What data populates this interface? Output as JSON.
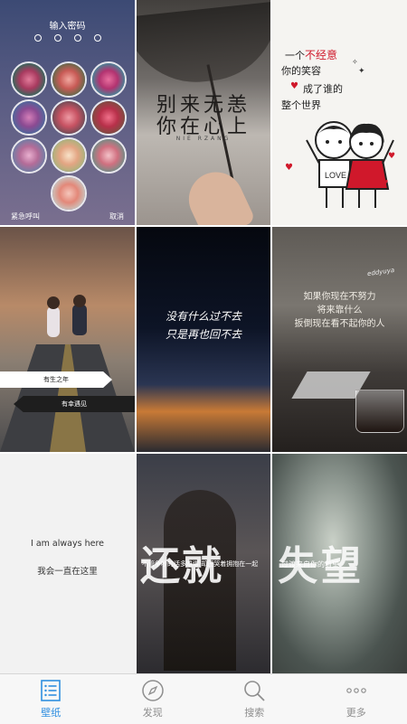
{
  "wallpapers": {
    "lock": {
      "title": "输入密码",
      "emergency": "紧急呼叫",
      "cancel": "取消"
    },
    "umbrella": {
      "line1": "别来无恙",
      "line2": "你在心上",
      "sub": "NIE RZANG"
    },
    "cartoon": {
      "line1a": "一个",
      "line1b": "不经意",
      "line2": "你的笑容",
      "line3": "成了谁的",
      "line4": "整个世界",
      "shirt": "LOVE"
    },
    "road": {
      "banner1": "有生之年",
      "banner2": "有幸遇见"
    },
    "night": {
      "line1": "没有什么过不去",
      "line2": "只是再也回不去"
    },
    "coffee": {
      "signature": "eddyuya",
      "line1": "如果你现在不努力",
      "line2": "将来靠什么",
      "line3": "扳倒现在看不起你的人"
    },
    "quote": {
      "line1": "I am always here",
      "line2": "我会一直在这里"
    },
    "couple": {
      "big": "还就",
      "small": "不管争吵的话多难堪 却还哭着拥抱在一起"
    },
    "smoke": {
      "big": "失望",
      "small": "过渡来自你的着望"
    }
  },
  "tabbar": {
    "tabs": [
      {
        "label": "壁纸",
        "icon": "list-icon",
        "active": true
      },
      {
        "label": "发现",
        "icon": "compass-icon",
        "active": false
      },
      {
        "label": "搜索",
        "icon": "search-icon",
        "active": false
      },
      {
        "label": "更多",
        "icon": "more-icon",
        "active": false
      }
    ],
    "active_color": "#2f8fe0",
    "inactive_color": "#8e8e8e"
  }
}
